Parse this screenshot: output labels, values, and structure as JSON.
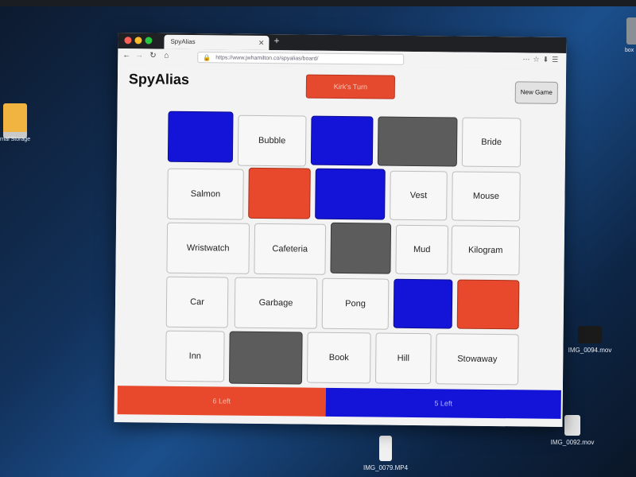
{
  "desktop": {
    "left_label": "rnal Storage",
    "right_top_label": "box",
    "right_mid_label": "IMG_0094.mov",
    "right_bottom_label": "IMG_0092.mov",
    "bottom_label": "IMG_0079.MP4"
  },
  "browser": {
    "tab_title": "SpyAlias",
    "url": "https://www.jwhamilton.co/spyalias/board/"
  },
  "app": {
    "logo": "SpyAlias",
    "turn_label": "Kirk's Turn",
    "new_game_label": "New Game",
    "score_red": "6 Left",
    "score_blue": "5 Left",
    "rows": [
      [
        {
          "word": "",
          "color": "blue"
        },
        {
          "word": "Bubble",
          "color": "none"
        },
        {
          "word": "",
          "color": "blue"
        },
        {
          "word": "",
          "color": "gray"
        },
        {
          "word": "Bride",
          "color": "none"
        }
      ],
      [
        {
          "word": "Salmon",
          "color": "none"
        },
        {
          "word": "",
          "color": "red"
        },
        {
          "word": "",
          "color": "blue"
        },
        {
          "word": "Vest",
          "color": "none"
        },
        {
          "word": "Mouse",
          "color": "none"
        }
      ],
      [
        {
          "word": "Wristwatch",
          "color": "none"
        },
        {
          "word": "Cafeteria",
          "color": "none"
        },
        {
          "word": "",
          "color": "gray"
        },
        {
          "word": "Mud",
          "color": "none"
        },
        {
          "word": "Kilogram",
          "color": "none"
        }
      ],
      [
        {
          "word": "Car",
          "color": "none"
        },
        {
          "word": "Garbage",
          "color": "none"
        },
        {
          "word": "Pong",
          "color": "none"
        },
        {
          "word": "",
          "color": "blue"
        },
        {
          "word": "",
          "color": "red"
        }
      ],
      [
        {
          "word": "Inn",
          "color": "none"
        },
        {
          "word": "",
          "color": "gray"
        },
        {
          "word": "Book",
          "color": "none"
        },
        {
          "word": "Hill",
          "color": "none"
        },
        {
          "word": "Stowaway",
          "color": "none"
        }
      ]
    ]
  }
}
